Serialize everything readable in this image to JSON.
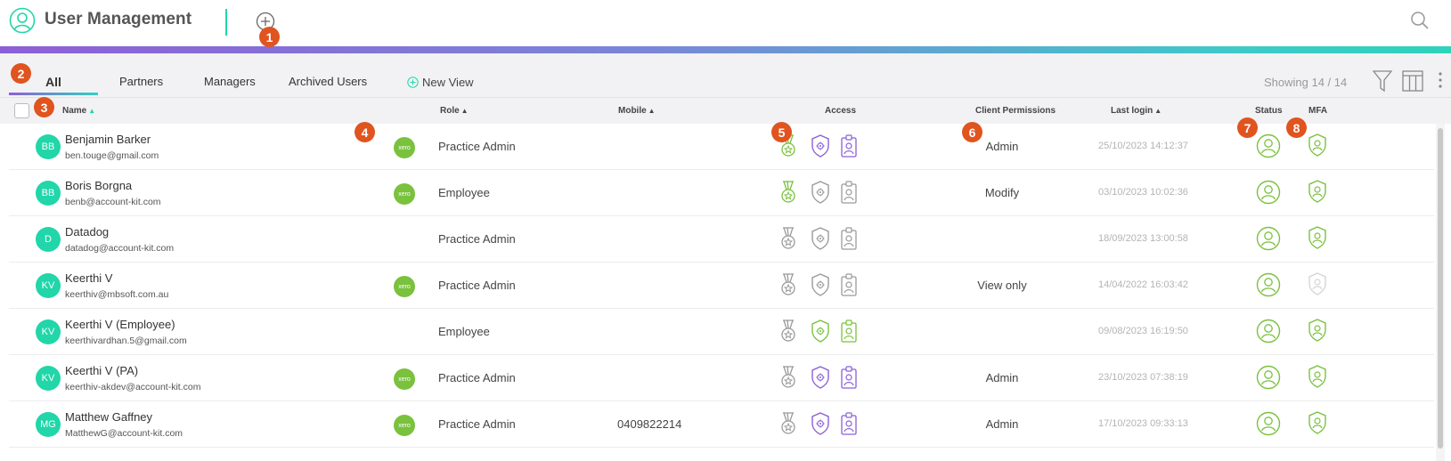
{
  "header": {
    "title": "User Management",
    "icons": {
      "logo": "user-circle-icon",
      "add": "plus-circle-icon",
      "search": "search-icon"
    }
  },
  "badges": [
    "1",
    "2",
    "3",
    "4",
    "5",
    "6",
    "7",
    "8"
  ],
  "tabs": [
    {
      "label": "All",
      "active": true
    },
    {
      "label": "Partners",
      "active": false
    },
    {
      "label": "Managers",
      "active": false
    },
    {
      "label": "Archived Users",
      "active": false
    }
  ],
  "new_view_label": "New View",
  "showing_text": "Showing 14 / 14",
  "columns": {
    "name": "Name",
    "role": "Role",
    "mobile": "Mobile",
    "access": "Access",
    "client_permissions": "Client Permissions",
    "last_login": "Last login",
    "status": "Status",
    "mfa": "MFA"
  },
  "xero_label": "xero",
  "colors": {
    "accent": "#21d6a8",
    "active_green": "#7ac13e",
    "active_purple": "#8b5fd6",
    "inactive_grey": "#9a9a9a",
    "badge": "#e0541f"
  },
  "users": [
    {
      "initials": "BB",
      "name": "Benjamin Barker",
      "email": "ben.touge@gmail.com",
      "xero": true,
      "role": "Practice Admin",
      "mobile": "",
      "access": [
        "green",
        "purple",
        "purple"
      ],
      "permission": "Admin",
      "last_login": "25/10/2023 14:12:37",
      "status": "active",
      "mfa": "active"
    },
    {
      "initials": "BB",
      "name": "Boris Borgna",
      "email": "benb@account-kit.com",
      "xero": true,
      "role": "Employee",
      "mobile": "",
      "access": [
        "green",
        "grey",
        "grey"
      ],
      "permission": "Modify",
      "last_login": "03/10/2023 10:02:36",
      "status": "active",
      "mfa": "active"
    },
    {
      "initials": "D",
      "name": "Datadog",
      "email": "datadog@account-kit.com",
      "xero": false,
      "role": "Practice Admin",
      "mobile": "",
      "access": [
        "grey",
        "grey",
        "grey"
      ],
      "permission": "",
      "last_login": "18/09/2023 13:00:58",
      "status": "active",
      "mfa": "active"
    },
    {
      "initials": "KV",
      "name": "Keerthi V",
      "email": "keerthiv@mbsoft.com.au",
      "xero": true,
      "role": "Practice Admin",
      "mobile": "",
      "access": [
        "grey",
        "grey",
        "grey"
      ],
      "permission": "View only",
      "last_login": "14/04/2022 16:03:42",
      "status": "active",
      "mfa": "inactive"
    },
    {
      "initials": "KV",
      "name": "Keerthi V (Employee)",
      "email": "keerthivardhan.5@gmail.com",
      "xero": false,
      "role": "Employee",
      "mobile": "",
      "access": [
        "grey",
        "green",
        "green"
      ],
      "permission": "",
      "last_login": "09/08/2023 16:19:50",
      "status": "active",
      "mfa": "active"
    },
    {
      "initials": "KV",
      "name": "Keerthi V (PA)",
      "email": "keerthiv-akdev@account-kit.com",
      "xero": true,
      "role": "Practice Admin",
      "mobile": "",
      "access": [
        "grey",
        "purple",
        "purple"
      ],
      "permission": "Admin",
      "last_login": "23/10/2023 07:38:19",
      "status": "active",
      "mfa": "active"
    },
    {
      "initials": "MG",
      "name": "Matthew Gaffney",
      "email": "MatthewG@account-kit.com",
      "xero": true,
      "role": "Practice Admin",
      "mobile": "0409822214",
      "access": [
        "grey",
        "purple",
        "purple"
      ],
      "permission": "Admin",
      "last_login": "17/10/2023 09:33:13",
      "status": "active",
      "mfa": "active"
    }
  ]
}
